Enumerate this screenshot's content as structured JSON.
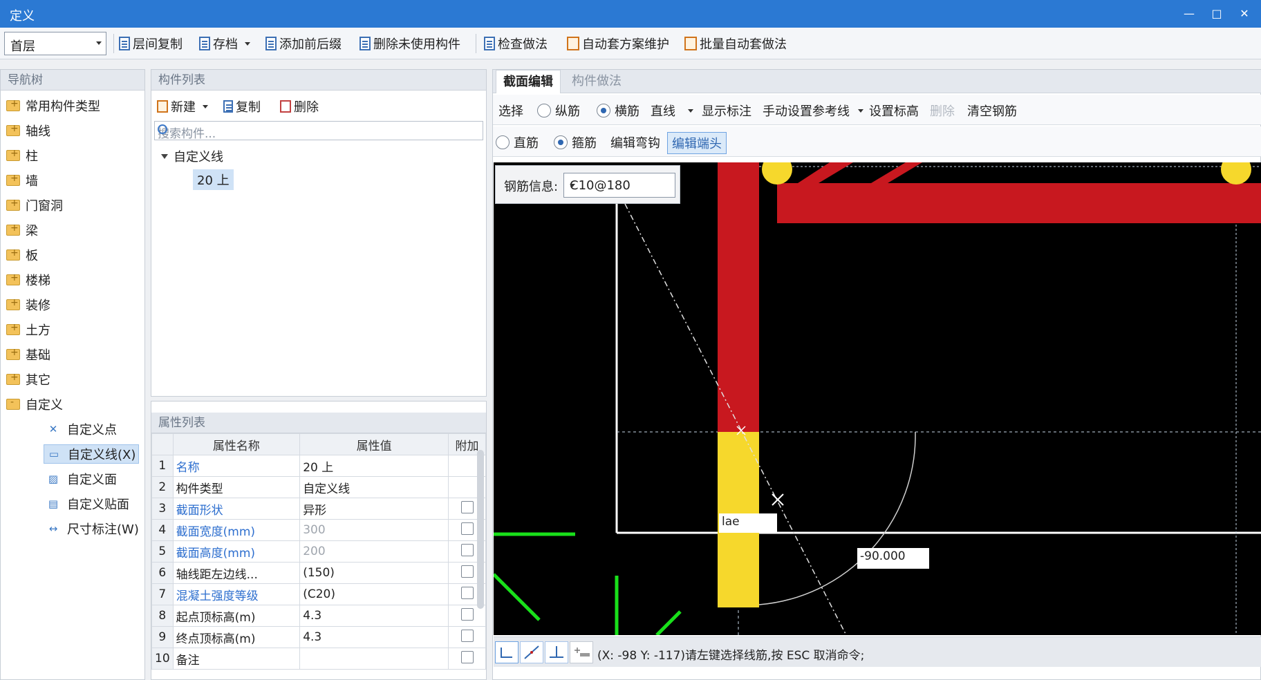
{
  "window": {
    "title": "定义",
    "minimize": "—",
    "maximize": "□",
    "close": "✕"
  },
  "toolbar": {
    "floor": "首层",
    "buttons": [
      "层间复制",
      "存档",
      "添加前后缀",
      "删除未使用构件",
      "检查做法",
      "自动套方案维护",
      "批量自动套做法"
    ]
  },
  "nav": {
    "header": "导航树",
    "items": [
      "常用构件类型",
      "轴线",
      "柱",
      "墙",
      "门窗洞",
      "梁",
      "板",
      "楼梯",
      "装修",
      "土方",
      "基础",
      "其它",
      "自定义"
    ],
    "children": [
      "自定义点",
      "自定义线(X)",
      "自定义面",
      "自定义贴面",
      "尺寸标注(W)"
    ]
  },
  "component_list": {
    "header": "构件列表",
    "new": "新建",
    "copy": "复制",
    "delete": "删除",
    "search_placeholder": "搜索构件...",
    "root": "自定义线",
    "leaf": "20 上"
  },
  "properties": {
    "header": "属性列表",
    "columns": [
      "属性名称",
      "属性值",
      "附加"
    ],
    "rows": [
      {
        "n": "1",
        "name": "名称",
        "value": "20 上"
      },
      {
        "n": "2",
        "name": "构件类型",
        "value": "自定义线"
      },
      {
        "n": "3",
        "name": "截面形状",
        "value": "异形"
      },
      {
        "n": "4",
        "name": "截面宽度(mm)",
        "value": "300"
      },
      {
        "n": "5",
        "name": "截面高度(mm)",
        "value": "200"
      },
      {
        "n": "6",
        "name": "轴线距左边线...",
        "value": "(150)"
      },
      {
        "n": "7",
        "name": "混凝土强度等级",
        "value": "(C20)"
      },
      {
        "n": "8",
        "name": "起点顶标高(m)",
        "value": "4.3"
      },
      {
        "n": "9",
        "name": "终点顶标高(m)",
        "value": "4.3"
      },
      {
        "n": "10",
        "name": "备注",
        "value": ""
      }
    ]
  },
  "editor": {
    "tabs": [
      "截面编辑",
      "构件做法"
    ],
    "row1": {
      "select": "选择",
      "longitudinal": "纵筋",
      "transverse": "横筋",
      "line_type": "直线",
      "show_dims": "显示标注",
      "manual_ref": "手动设置参考线",
      "set_elev": "设置标高",
      "delete": "删除",
      "clear": "清空钢筋"
    },
    "row2": {
      "straight": "直筋",
      "stirrup": "箍筋",
      "edit_hook": "编辑弯钩",
      "edit_end": "编辑端头"
    },
    "rebar_info_label": "钢筋信息:",
    "rebar_info_value": "C10@180",
    "label_lae": "lae",
    "label_angle": "-90.000",
    "status": "(X: -98 Y: -117)请左键选择线筋,按 ESC 取消命令;"
  },
  "colors": {
    "titlebar": "#2b79d3",
    "rebar_red": "#c8181f",
    "rebar_yellow": "#f6d82c",
    "green": "#19e01a"
  }
}
